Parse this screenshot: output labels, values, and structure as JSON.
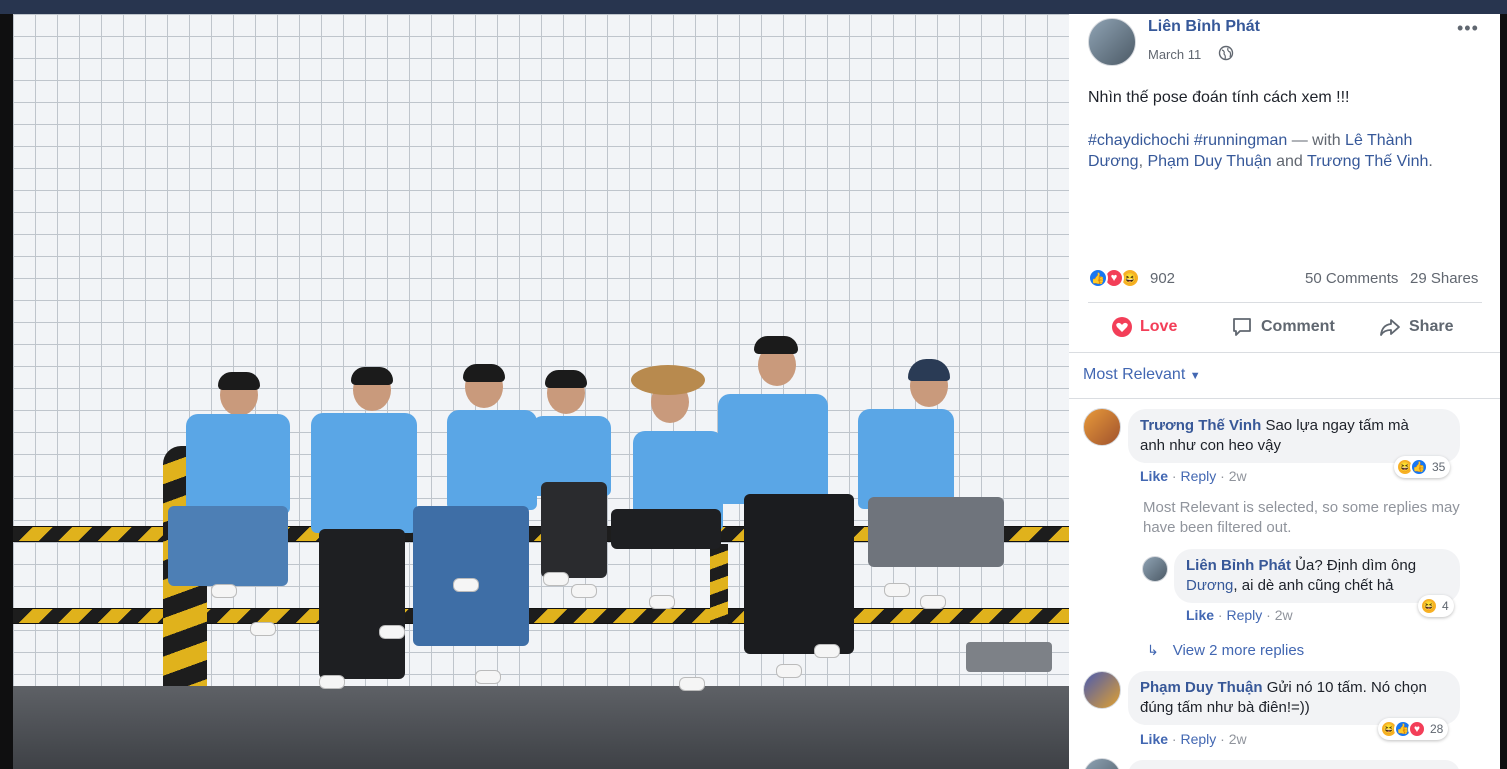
{
  "post": {
    "author": "Liên Bỉnh Phát",
    "date": "March 11",
    "text": "Nhìn thế pose đoán tính cách xem !!!",
    "hashtags": "#chaydichochi #runningman",
    "with_prefix": " — with ",
    "tagged_1a": "Lê Thành",
    "tagged_1b": "Dương",
    "tagged_2": "Phạm Duy Thuận",
    "and_word": " and ",
    "tagged_3": "Trương Thế Vinh",
    "period": ".",
    "more_icon": "more-options-icon",
    "privacy_icon": "globe-icon"
  },
  "stats": {
    "reactions": "902",
    "comments": "50 Comments",
    "shares": "29 Shares"
  },
  "actions": {
    "love": "Love",
    "comment": "Comment",
    "share": "Share"
  },
  "sort_label": "Most Relevant",
  "comments": [
    {
      "name": "Trương Thế Vinh",
      "text_line1": "Sao lựa ngay tấm mà",
      "text_line2": "anh như con heo vậy",
      "like": "Like",
      "reply": "Reply",
      "time": "2w",
      "reactions": "35"
    },
    {
      "name": "Phạm Duy Thuận",
      "text_line1": "Gửi nó 10 tấm. Nó chọn",
      "text_line2": "đúng tấm như bà điên!=))",
      "like": "Like",
      "reply": "Reply",
      "time": "2w",
      "reactions": "28"
    }
  ],
  "filtered_note": "Most Relevant is selected, so some replies may have been filtered out.",
  "reply": {
    "name": "Liên Bỉnh Phát",
    "text_line1": "Ủa? Định dìm ông",
    "mention": "Dương",
    "text_line2_rest": ", ai dè anh cũng chết hả",
    "like": "Like",
    "reply": "Reply",
    "time": "2w",
    "reactions": "4"
  },
  "view_more": "View 2 more replies",
  "colors": {
    "link": "#365899",
    "love": "#f33e58",
    "like": "#1877f2",
    "shirt": "#5aa6e6"
  }
}
